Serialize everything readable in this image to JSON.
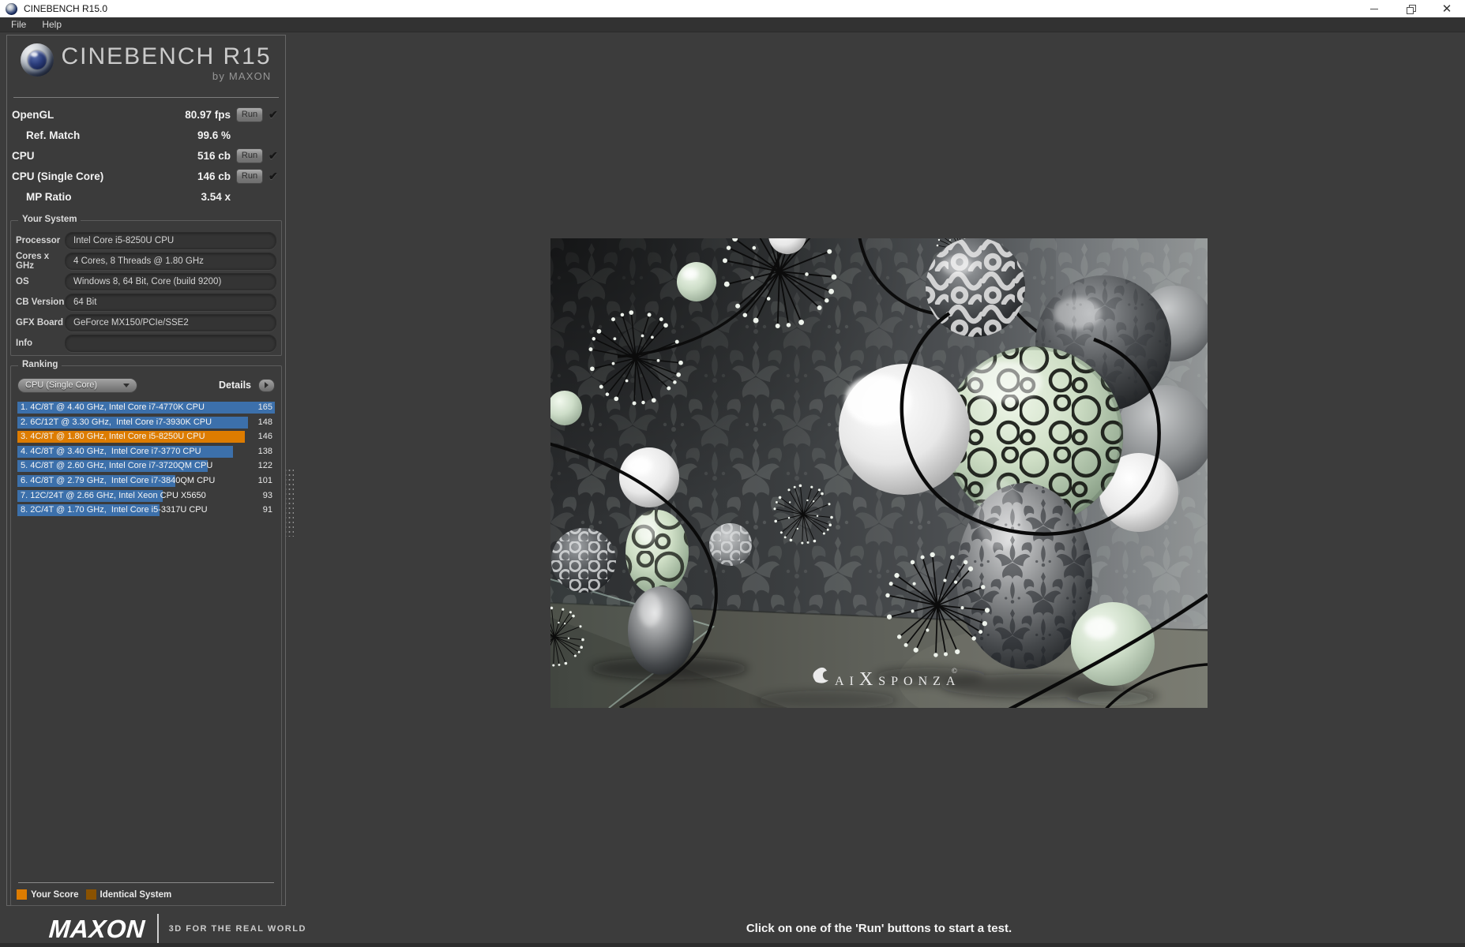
{
  "window": {
    "title": "CINEBENCH R15.0",
    "menu": [
      "File",
      "Help"
    ]
  },
  "icons": {
    "app": "cinebench-ball",
    "minimize": "minimize-line",
    "restore": "overlapping-squares",
    "close": "x-cross",
    "check": "✔",
    "dropdown_arrow": "▼",
    "details_arrow": "▶"
  },
  "logo": {
    "title": "CINEBENCH R15",
    "subtitle": "by MAXON"
  },
  "results": {
    "run_label": "Run",
    "check_glyph": "✔",
    "rows": [
      {
        "label": "OpenGL",
        "value": "80.97 fps",
        "indent": false,
        "run": true,
        "done": true
      },
      {
        "label": "Ref. Match",
        "value": "99.6 %",
        "indent": true,
        "run": false,
        "done": false
      },
      {
        "label": "CPU",
        "value": "516 cb",
        "indent": false,
        "run": true,
        "done": true
      },
      {
        "label": "CPU (Single Core)",
        "value": "146 cb",
        "indent": false,
        "run": true,
        "done": true
      },
      {
        "label": "MP Ratio",
        "value": "3.54 x",
        "indent": true,
        "run": false,
        "done": false
      }
    ]
  },
  "your_system": {
    "title": "Your System",
    "fields": [
      {
        "label": "Processor",
        "value": "Intel Core i5-8250U CPU"
      },
      {
        "label": "Cores x GHz",
        "value": "4 Cores, 8 Threads @ 1.80 GHz"
      },
      {
        "label": "OS",
        "value": "Windows 8, 64 Bit, Core (build 9200)"
      },
      {
        "label": "CB Version",
        "value": "64 Bit"
      },
      {
        "label": "GFX Board",
        "value": "GeForce MX150/PCIe/SSE2"
      },
      {
        "label": "Info",
        "value": ""
      }
    ]
  },
  "ranking": {
    "title": "Ranking",
    "dropdown_value": "CPU (Single Core)",
    "details_label": "Details",
    "max_score": 165,
    "colors": {
      "blue": "#3c70ab",
      "orange": "#dd7c00"
    },
    "rows": [
      {
        "label": "1. 4C/8T @ 4.40 GHz, Intel Core i7-4770K CPU",
        "score": 165,
        "color": "blue"
      },
      {
        "label": "2. 6C/12T @ 3.30 GHz,  Intel Core i7-3930K CPU",
        "score": 148,
        "color": "blue"
      },
      {
        "label": "3. 4C/8T @ 1.80 GHz, Intel Core i5-8250U CPU",
        "score": 146,
        "color": "orange"
      },
      {
        "label": "4. 4C/8T @ 3.40 GHz,  Intel Core i7-3770 CPU",
        "score": 138,
        "color": "blue"
      },
      {
        "label": "5. 4C/8T @ 2.60 GHz, Intel Core i7-3720QM CPU",
        "score": 122,
        "color": "blue"
      },
      {
        "label": "6. 4C/8T @ 2.79 GHz,  Intel Core i7-3840QM CPU",
        "score": 101,
        "color": "blue"
      },
      {
        "label": "7. 12C/24T @ 2.66 GHz, Intel Xeon CPU X5650",
        "score": 93,
        "color": "blue"
      },
      {
        "label": "8. 2C/4T @ 1.70 GHz,  Intel Core i5-3317U CPU",
        "score": 91,
        "color": "blue"
      }
    ]
  },
  "legend": {
    "items": [
      {
        "label": "Your Score",
        "color": "#dd7c00"
      },
      {
        "label": "Identical System",
        "color": "#8a5200"
      }
    ]
  },
  "footer": {
    "brand": "MAXON",
    "tagline": "3D FOR THE REAL WORLD"
  },
  "status": "Click on one of the 'Run' buttons to start a test.",
  "scene": {
    "wm": [
      "AI",
      "X",
      "SPONZA"
    ],
    "copyright": "©"
  }
}
